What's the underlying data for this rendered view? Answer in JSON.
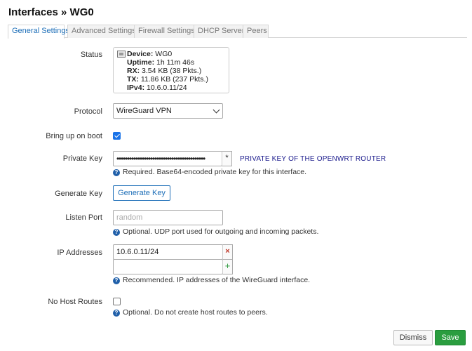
{
  "title": "Interfaces » WG0",
  "tabs": [
    {
      "label": "General Settings"
    },
    {
      "label": "Advanced Settings"
    },
    {
      "label": "Firewall Settings"
    },
    {
      "label": "DHCP Server"
    },
    {
      "label": "Peers"
    }
  ],
  "status": {
    "label": "Status",
    "device_key": "Device:",
    "device_val": "WG0",
    "uptime_key": "Uptime:",
    "uptime_val": "1h 11m 46s",
    "rx_key": "RX:",
    "rx_val": "3.54 KB (38 Pkts.)",
    "tx_key": "TX:",
    "tx_val": "11.86 KB (237 Pkts.)",
    "ipv4_key": "IPv4:",
    "ipv4_val": "10.6.0.11/24"
  },
  "protocol": {
    "label": "Protocol",
    "value": "WireGuard VPN"
  },
  "bring_up": {
    "label": "Bring up on boot",
    "checked": true
  },
  "private_key": {
    "label": "Private Key",
    "value": "••••••••••••••••••••••••••••••••••••••••••",
    "toggle": "*",
    "annotation": "PRIVATE KEY OF THE OPENWRT ROUTER",
    "help": "Required. Base64-encoded private key for this interface."
  },
  "generate_key": {
    "label": "Generate Key",
    "button": "Generate Key"
  },
  "listen_port": {
    "label": "Listen Port",
    "placeholder": "random",
    "help": "Optional. UDP port used for outgoing and incoming packets."
  },
  "ip_addresses": {
    "label": "IP Addresses",
    "values": [
      "10.6.0.11/24",
      ""
    ],
    "remove_glyph": "×",
    "add_glyph": "+",
    "help": "Recommended. IP addresses of the WireGuard interface."
  },
  "no_host_routes": {
    "label": "No Host Routes",
    "checked": false,
    "help": "Optional. Do not create host routes to peers."
  },
  "help_glyph": "?",
  "footer": {
    "dismiss": "Dismiss",
    "save": "Save"
  },
  "colors": {
    "accent": "#1e6fb8",
    "save": "#2a9d3f",
    "checkbox": "#1a73e8",
    "remove": "#c0392b",
    "add": "#2e9a3e"
  }
}
